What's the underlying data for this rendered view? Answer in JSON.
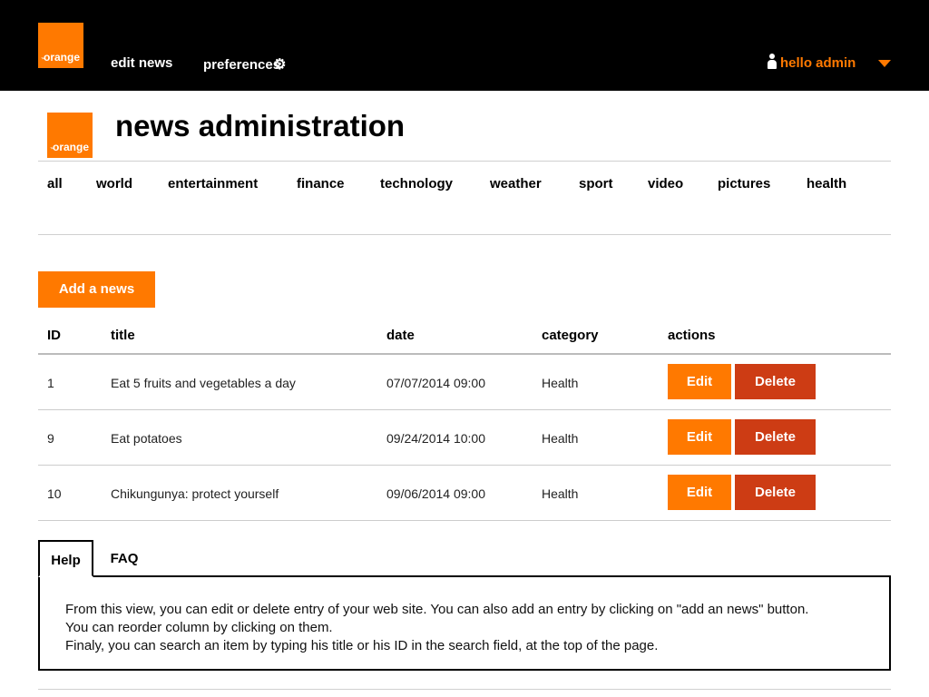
{
  "brand": {
    "logo_text": "orange",
    "logo_mark": "™",
    "color": "#ff7900"
  },
  "topnav": {
    "edit_news": "edit news",
    "preferences": "preferences"
  },
  "user": {
    "label": "hello admin"
  },
  "page": {
    "title": "news administration"
  },
  "categories": [
    "all",
    "world",
    "entertainment",
    "finance",
    "technology",
    "weather",
    "sport",
    "video",
    "pictures",
    "health"
  ],
  "toolbar": {
    "add_label": "Add a news"
  },
  "table": {
    "headers": {
      "id": "ID",
      "title": "title",
      "date": "date",
      "category": "category",
      "actions": "actions"
    },
    "rows": [
      {
        "id": "1",
        "title": "Eat 5 fruits and vegetables a day",
        "date": "07/07/2014 09:00",
        "category": "Health",
        "edit": "Edit",
        "delete": "Delete"
      },
      {
        "id": "9",
        "title": "Eat potatoes",
        "date": "09/24/2014 10:00",
        "category": "Health",
        "edit": "Edit",
        "delete": "Delete"
      },
      {
        "id": "10",
        "title": "Chikungunya: protect yourself",
        "date": "09/06/2014 09:00",
        "category": "Health",
        "edit": "Edit",
        "delete": "Delete"
      }
    ]
  },
  "tabs": {
    "help": "Help",
    "faq": "FAQ"
  },
  "help": {
    "line1": "From this view, you can edit or delete entry of your web site. You can also add an entry by clicking on \"add an news\" button.",
    "line2": "You can reorder column by clicking on them.",
    "line3": "Finaly, you can search an item by typing his title or his ID in the search field, at the top of the page."
  },
  "colors": {
    "accent": "#ff7900",
    "danger": "#cd3c14",
    "topbar": "#000000"
  }
}
